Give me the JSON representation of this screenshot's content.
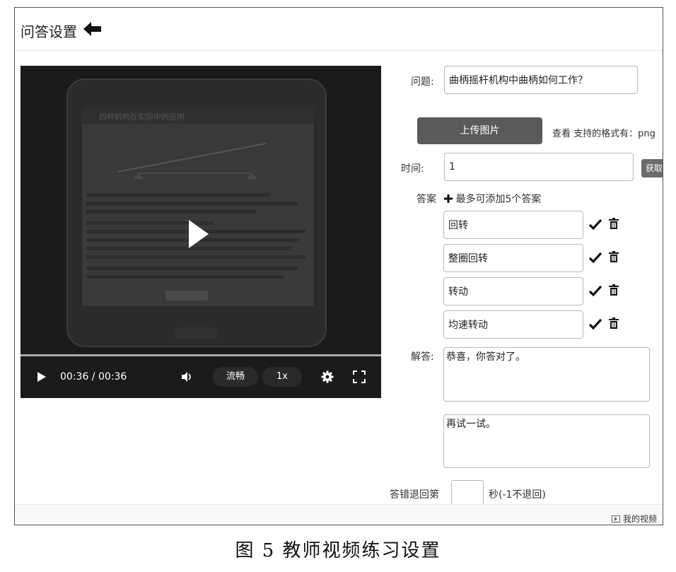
{
  "header": {
    "title": "问答设置",
    "back_icon": "arrow-left-icon"
  },
  "player": {
    "screen_title": "四杆机构在实际中的应用",
    "time": "00:36 / 00:36",
    "progress": 1.0,
    "quality": "流畅",
    "speed": "1x"
  },
  "form": {
    "question_label": "问题:",
    "question_value": "曲柄摇杆机构中曲柄如何工作？",
    "upload_label": "上传图片",
    "formats_text": "查看 支持的格式有：png",
    "time_label": "时间:",
    "time_value": "1",
    "fetch_label": "获取",
    "answers_label": "答案",
    "add_answer_text": "最多可添加5个答案",
    "answers": [
      "回转",
      "整圈回转",
      "转动",
      "均速转动"
    ],
    "explain_label": "解答:",
    "explain_text": "恭喜，你答对了。",
    "retry_text": "再试一试。",
    "back_prefix": "答错退回第",
    "back_suffix": "秒(-1不退回)"
  },
  "footer": {
    "my_videos": "我的视频"
  },
  "caption": "图 5   教师视频练习设置"
}
